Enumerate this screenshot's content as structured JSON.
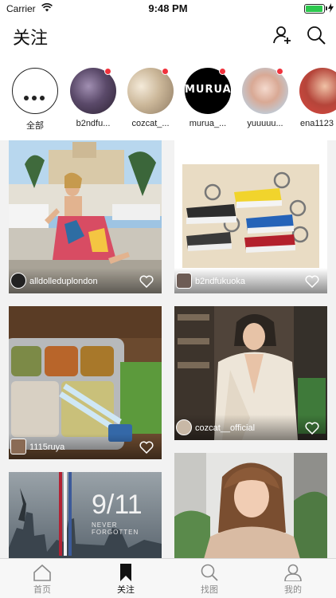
{
  "status_bar": {
    "carrier": "Carrier",
    "time": "9:48 PM",
    "battery_level": 0.95
  },
  "header": {
    "title": "关注",
    "icons": [
      "add-user-icon",
      "search-icon"
    ]
  },
  "stories": [
    {
      "label": "全部",
      "type": "all",
      "new": false
    },
    {
      "label": "b2ndfu...",
      "new": true
    },
    {
      "label": "cozcat_...",
      "new": true
    },
    {
      "label": "murua_...",
      "new": true,
      "logo_text": "MURUA"
    },
    {
      "label": "yuuuuu...",
      "new": true
    },
    {
      "label": "ena1123",
      "new": false
    }
  ],
  "feed": [
    {
      "username": "alldolleduplondon",
      "liked": false
    },
    {
      "username": "b2ndfukuoka",
      "liked": false
    },
    {
      "username": "1115ruya",
      "liked": false
    },
    {
      "username": "cozcat__official",
      "liked": false
    },
    {
      "username": "",
      "overlay_title": "9/11",
      "overlay_subtitle": "NEVER FORGOTTEN"
    },
    {
      "username": ""
    }
  ],
  "tabbar": [
    {
      "label": "首页",
      "icon": "home-icon",
      "active": false
    },
    {
      "label": "关注",
      "icon": "bookmark-icon",
      "active": true
    },
    {
      "label": "找图",
      "icon": "search-icon",
      "active": false
    },
    {
      "label": "我的",
      "icon": "profile-icon",
      "active": false
    }
  ],
  "colors": {
    "accent": "#111111",
    "new_dot": "#f0323c",
    "battery": "#2cc84d"
  }
}
